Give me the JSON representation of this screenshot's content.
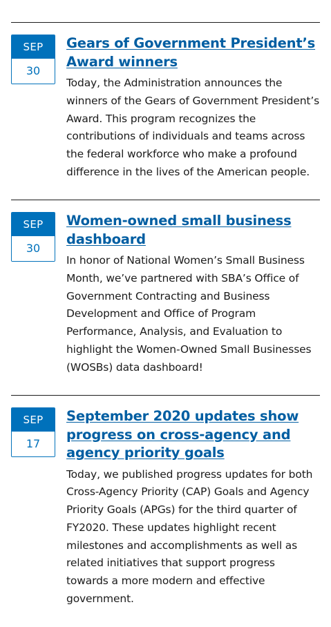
{
  "posts": [
    {
      "month": "SEP",
      "day": "30",
      "title": "Gears of Government President’s Award winners",
      "summary": "Today, the Administration announces the winners of the Gears of Government President’s Award. This program recognizes the contributions of individuals and teams across the federal workforce who make a profound difference in the lives of the American people."
    },
    {
      "month": "SEP",
      "day": "30",
      "title": "Women-owned small business dashboard",
      "summary": "In honor of National Women’s Small Business Month, we’ve partnered with SBA’s Office of Government Contracting and Business Development and Office of Program Performance, Analysis, and Evaluation to highlight the Women-Owned Small Businesses (WOSBs) data dashboard!"
    },
    {
      "month": "SEP",
      "day": "17",
      "title": "September 2020 updates show progress on cross-agency and agency priority goals",
      "summary": "Today, we published progress updates for both Cross-Agency Priority (CAP) Goals and Agency Priority Goals (APGs) for the third quarter of FY2020. These updates highlight recent milestones and accomplishments as well as related initiatives that support progress towards a more modern and effective government."
    }
  ],
  "colors": {
    "accent": "#0071bb",
    "link": "#005ea2",
    "text": "#1b1b1b",
    "divider": "#1b1b1b"
  }
}
